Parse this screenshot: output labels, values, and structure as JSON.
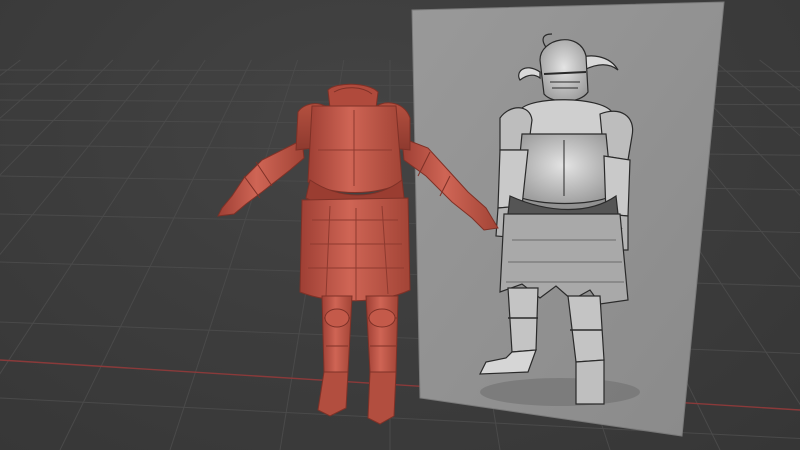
{
  "viewport": {
    "background": "#3d3d3d",
    "grid_color": "#4a4a4a",
    "x_axis_color": "#8a3a3a",
    "y_axis_color": "#5a7a3a"
  },
  "scene": {
    "sculpt_material_color": "#c7584a",
    "reference_plane_color": "#8f8f8f",
    "objects": [
      {
        "kind": "armor-sculpt",
        "description_icon": "mesh-icon"
      },
      {
        "kind": "reference-image-plane",
        "description_icon": "image-icon"
      }
    ]
  }
}
